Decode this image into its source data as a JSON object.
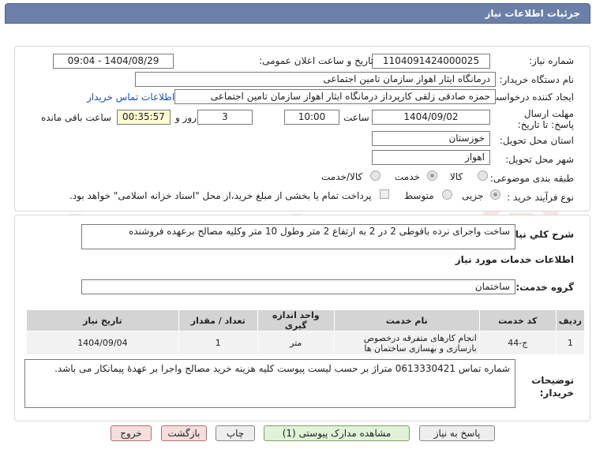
{
  "header": {
    "title": "جزئیات اطلاعات نیاز"
  },
  "form": {
    "need_number_label": "شماره نیاز:",
    "need_number": "1104091424000025",
    "announce_label": "تاریخ و ساعت اعلان عمومی:",
    "announce_value": "1404/08/29 - 09:04",
    "buyer_org_label": "نام دستگاه خریدار:",
    "buyer_org": "درمانگاه ایثار اهواز سازمان تامین اجتماعی",
    "creator_label": "ایجاد کننده درخواست:",
    "creator": "حمزه صادقی زلقی کارپرداز درمانگاه ایثار اهواز سازمان تامین اجتماعی",
    "contact_link": "اطلاعات تماس خریدار",
    "deadline_label": "مهلت ارسال پاسخ: تا تاریخ:",
    "deadline_date": "1404/09/02",
    "time_label": "ساعت",
    "deadline_time": "10:00",
    "days_value": "3",
    "days_label": "روز و",
    "remaining_time": "00:35:57",
    "remaining_label": "ساعت باقی مانده",
    "province_label": "استان محل تحویل:",
    "province": "خوزستان",
    "city_label": "شهر محل تحویل:",
    "city": "اهواز",
    "category_label": "طبقه بندی موضوعی:",
    "category_options": [
      "کالا",
      "خدمت",
      "کالا/خدمت"
    ],
    "process_label": "نوع فرآیند خرید :",
    "process_options": [
      "جزیی",
      "متوسط"
    ],
    "payment_note": "پرداخت تمام یا بخشی از مبلغ خرید،از محل \"اسناد خزانه اسلامی\" خواهد بود."
  },
  "summary": {
    "label": "شرح کلي نياز:",
    "text": "ساخت واجرای نرده باقوطی 2 در 2 به ارتفاع 2 متر وطول 10 متر وکلیه مصالح برعهده فروشنده"
  },
  "services": {
    "section_title": "اطلاعات خدمات مورد نیاز",
    "group_label": "گروه خدمت:",
    "group_value": "ساختمان",
    "columns": [
      "ردیف",
      "کد خدمت",
      "نام خدمت",
      "واحد اندازه گیری",
      "تعداد / مقدار",
      "تاریخ نیاز"
    ],
    "rows": [
      {
        "row": "1",
        "code": "ج-44",
        "name": "انجام کارهای متفرقه درخصوص بازسازی و بهسازی ساختمان ها",
        "unit": "متر",
        "qty": "1",
        "date": "1404/09/04"
      }
    ]
  },
  "notes": {
    "label": "توضیحات خریدار:",
    "text": "شماره تماس 0613330421 متراژ بر حسب لیست پیوست کلیه هزینه خرید مصالح واجرا بر عهدهٔ پیمانکار می باشد."
  },
  "buttons": {
    "reply": "پاسخ به نیاز",
    "attachments": "مشاهده مدارک پیوستی (1)",
    "print": "چاپ",
    "back": "بازگشت",
    "exit": "خروج"
  },
  "watermark": "AriaTender.net"
}
